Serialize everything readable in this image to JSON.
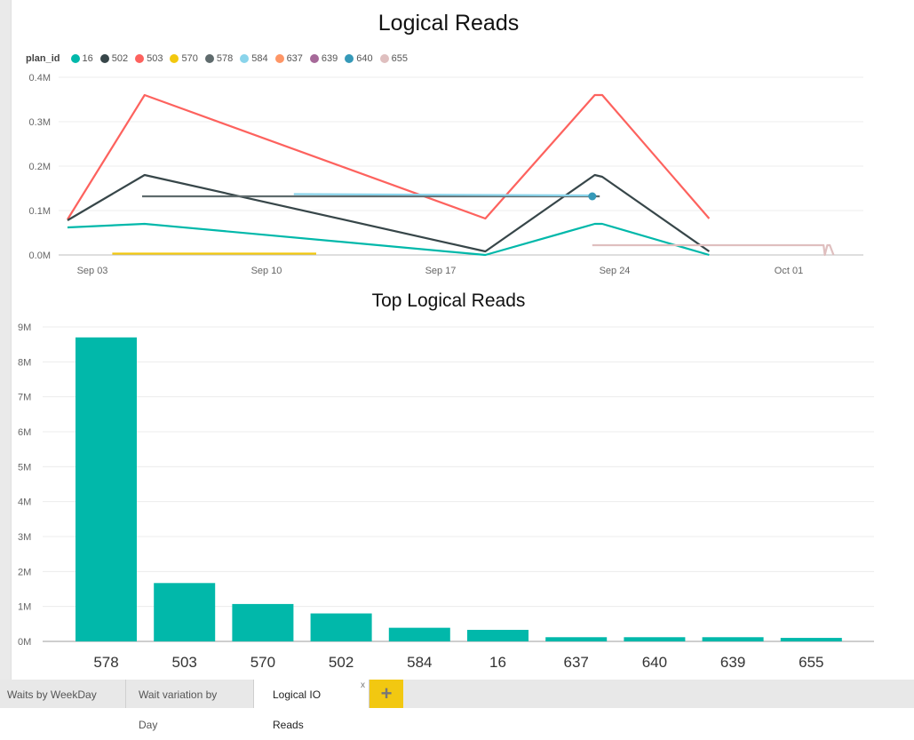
{
  "tabs": [
    {
      "label": "Waits by WeekDay",
      "active": false
    },
    {
      "label": "Wait variation by Day",
      "active": false
    },
    {
      "label": "Logical IO Reads",
      "active": true,
      "close_label": "x"
    }
  ],
  "add_tab_label": "+",
  "legend": {
    "title": "plan_id",
    "items": [
      {
        "label": "16",
        "color": "#01B8AA"
      },
      {
        "label": "502",
        "color": "#374649"
      },
      {
        "label": "503",
        "color": "#FD625E"
      },
      {
        "label": "570",
        "color": "#F2C80F"
      },
      {
        "label": "578",
        "color": "#5F6B6D"
      },
      {
        "label": "584",
        "color": "#8AD4EB"
      },
      {
        "label": "637",
        "color": "#FE9666"
      },
      {
        "label": "639",
        "color": "#A66999"
      },
      {
        "label": "640",
        "color": "#3599B8"
      },
      {
        "label": "655",
        "color": "#DFBFBF"
      }
    ]
  },
  "chart_data": [
    {
      "type": "line",
      "title": "Logical Reads",
      "xlabel": "",
      "ylabel": "",
      "ylim": [
        0,
        0.4
      ],
      "y_unit": "M",
      "yticks": [
        "0.0M",
        "0.1M",
        "0.2M",
        "0.3M",
        "0.4M"
      ],
      "x_range_days": [
        "2017-09-02",
        "2017-10-04"
      ],
      "xticks": [
        {
          "label": "Sep 03",
          "day": 1
        },
        {
          "label": "Sep 10",
          "day": 8
        },
        {
          "label": "Sep 17",
          "day": 15
        },
        {
          "label": "Sep 24",
          "day": 22
        },
        {
          "label": "Oct 01",
          "day": 29
        }
      ],
      "x_note": "day = days since Sep 02",
      "grid": true,
      "legend_position": "top-left",
      "series": [
        {
          "name": "503",
          "color": "#FD625E",
          "points": [
            [
              0.0,
              0.08
            ],
            [
              3.1,
              0.36
            ],
            [
              16.8,
              0.082
            ],
            [
              21.2,
              0.36
            ],
            [
              21.5,
              0.36
            ],
            [
              25.8,
              0.082
            ]
          ]
        },
        {
          "name": "502",
          "color": "#374649",
          "points": [
            [
              0.0,
              0.078
            ],
            [
              3.1,
              0.18
            ],
            [
              16.8,
              0.008
            ],
            [
              21.2,
              0.18
            ],
            [
              21.5,
              0.176
            ],
            [
              25.8,
              0.008
            ]
          ]
        },
        {
          "name": "16",
          "color": "#01B8AA",
          "points": [
            [
              0.0,
              0.062
            ],
            [
              3.1,
              0.07
            ],
            [
              16.8,
              0.0
            ],
            [
              21.2,
              0.07
            ],
            [
              21.5,
              0.07
            ],
            [
              25.8,
              0.0
            ]
          ]
        },
        {
          "name": "578",
          "color": "#5F6B6D",
          "points": [
            [
              3.0,
              0.132
            ],
            [
              21.4,
              0.132
            ]
          ]
        },
        {
          "name": "584",
          "color": "#8AD4EB",
          "points": [
            [
              9.1,
              0.137
            ],
            [
              21.1,
              0.134
            ]
          ]
        },
        {
          "name": "640",
          "color": "#3599B8",
          "points": [
            [
              21.1,
              0.132
            ]
          ],
          "marker": true
        },
        {
          "name": "570",
          "color": "#F2C80F",
          "points": [
            [
              1.8,
              0.003
            ],
            [
              10.0,
              0.003
            ]
          ]
        },
        {
          "name": "655",
          "color": "#DFBFBF",
          "points": [
            [
              21.1,
              0.022
            ],
            [
              30.4,
              0.022
            ],
            [
              30.45,
              0.0
            ],
            [
              30.55,
              0.022
            ],
            [
              30.65,
              0.022
            ],
            [
              30.8,
              0.0
            ]
          ]
        }
      ]
    },
    {
      "type": "bar",
      "title": "Top Logical Reads",
      "xlabel": "",
      "ylabel": "",
      "ylim": [
        0,
        9
      ],
      "y_unit": "M",
      "yticks": [
        "0M",
        "1M",
        "2M",
        "3M",
        "4M",
        "5M",
        "6M",
        "7M",
        "8M",
        "9M"
      ],
      "grid": true,
      "color": "#01B8AA",
      "categories": [
        "578",
        "503",
        "570",
        "502",
        "584",
        "16",
        "637",
        "640",
        "639",
        "655"
      ],
      "values": [
        8.7,
        1.67,
        1.07,
        0.8,
        0.39,
        0.33,
        0.12,
        0.12,
        0.12,
        0.1
      ]
    }
  ]
}
